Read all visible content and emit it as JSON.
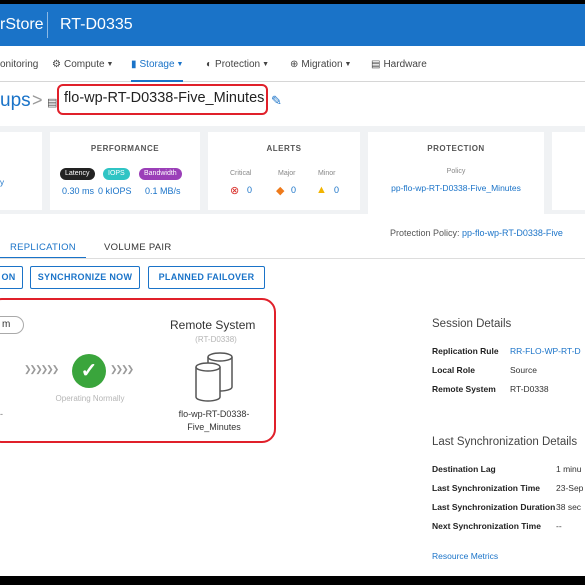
{
  "topbar": {
    "app_fragment": "rStore",
    "system_name": "RT-D0335"
  },
  "nav": {
    "monitoring": "onitoring",
    "compute": "Compute",
    "storage": "Storage",
    "protection": "Protection",
    "migration": "Migration",
    "hardware": "Hardware"
  },
  "breadcrumb": {
    "parent_fragment": "ups",
    "separator": ">",
    "object_name": "flo-wp-RT-D0338-Five_Minutes"
  },
  "cards": {
    "left_fragment": "y",
    "performance": {
      "title": "PERFORMANCE",
      "pills": [
        "Latency",
        "IOPS",
        "Bandwidth"
      ],
      "values": [
        "0.30 ms",
        "0 kIOPS",
        "0.1 MB/s"
      ],
      "pill_colors": [
        "#222222",
        "#2fc4c4",
        "#9b3fb8"
      ]
    },
    "alerts": {
      "title": "ALERTS",
      "labels": [
        "Critical",
        "Major",
        "Minor"
      ],
      "values": [
        "0",
        "0",
        "0"
      ],
      "colors": [
        "#d9302c",
        "#ee7a1b",
        "#f2b400"
      ]
    },
    "protection": {
      "title": "PROTECTION",
      "policy_label": "Policy",
      "policy_value": "pp-flo-wp-RT-D0338-Five_Minutes"
    }
  },
  "protection_policy": {
    "label": "Protection Policy:",
    "value": "pp-flo-wp-RT-D0338-Five"
  },
  "tabs": [
    "REPLICATION",
    "VOLUME PAIR"
  ],
  "buttons": {
    "left_fragment": "ON",
    "sync_now": "SYNCHRONIZE NOW",
    "planned_failover": "PLANNED FAILOVER"
  },
  "topology": {
    "local_fragment": "m",
    "status": "Operating Normally",
    "left_dash": "-",
    "remote_title": "Remote System",
    "remote_id": "(RT-D0338)",
    "remote_name": "flo-wp-RT-D0338-Five_Minutes"
  },
  "session_details": {
    "title": "Session Details",
    "rows": [
      {
        "key": "Replication Rule",
        "value": "RR-FLO-WP-RT-D"
      },
      {
        "key": "Local Role",
        "value": "Source"
      },
      {
        "key": "Remote System",
        "value": "RT-D0338"
      }
    ]
  },
  "last_sync": {
    "title": "Last Synchronization Details",
    "rows": [
      {
        "key": "Destination Lag",
        "value": "1 minu"
      },
      {
        "key": "Last Synchronization Time",
        "value": "23-Sep"
      },
      {
        "key": "Last Synchronization Duration",
        "value": "38 sec"
      },
      {
        "key": "Next Synchronization Time",
        "value": "--"
      }
    ],
    "resource_metrics": "Resource Metrics"
  },
  "colors": {
    "accent": "#1a73c8",
    "header": "#1a73c8",
    "highlight": "#e0202a",
    "ok": "#3aa53c"
  }
}
